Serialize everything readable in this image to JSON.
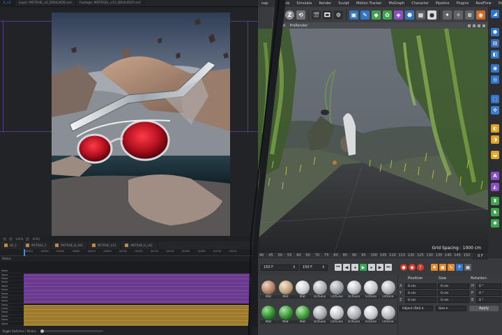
{
  "left_app": {
    "tabs": [
      {
        "label": "E_v2",
        "active": true
      },
      {
        "label": "Layer: MSTRHE_v2_DDHLOOD.ext",
        "active": false
      },
      {
        "label": "Footage: MSTRGEL_v12_BDHL0025.ext",
        "active": false
      }
    ],
    "viewer_controls": [
      "100%",
      "ACES"
    ],
    "layer_tabs": [
      "HE_1",
      "MSTRHE_2",
      "MSTRHE_D_001",
      "MSTRHE_V12",
      "MSTRHE_H_v02"
    ],
    "ruler_ticks": [
      "00015",
      "00030",
      "00045",
      "00060",
      "00075",
      "00090",
      "00105",
      "00120",
      "00135",
      "00150",
      "00165",
      "00180",
      "00195",
      "00210"
    ],
    "status_label": "Status",
    "layer_names": [
      "None",
      "None",
      "None",
      "None",
      "None",
      "None",
      "None",
      "None",
      "None",
      "None",
      "Lines",
      "None",
      "None",
      "None",
      "None"
    ],
    "bottom_label": "Toggle Switches / Modes",
    "colors": {
      "track_purple": "#6a3a8f",
      "track_gold": "#9c7a2e",
      "playhead": "#3a8ee6",
      "guides": "#6a3f9a"
    }
  },
  "right_app": {
    "menu": [
      "nap",
      "Animate",
      "Simulate",
      "Render",
      "Sculpt",
      "Motion Tracker",
      "MoGraph",
      "Character",
      "Pipeline",
      "Plugins",
      "RealFlow",
      "Octa"
    ],
    "panel_menu": [
      "Panel",
      "ProRender"
    ],
    "grid_spacing": "Grid Spacing : 1000 cm",
    "timeline_ticks": [
      "40",
      "45",
      "50",
      "55",
      "60",
      "65",
      "70",
      "75",
      "80",
      "85",
      "90",
      "95",
      "100",
      "105",
      "110",
      "115",
      "120",
      "125",
      "130",
      "135",
      "140",
      "145",
      "150"
    ],
    "current_frame": "0 F",
    "transport": {
      "start_field": "150 F",
      "end_field": "150 F"
    },
    "materials": [
      "Mat",
      "Mat",
      "Mat",
      "OctGlos",
      "OctGlos",
      "OctGlos",
      "Octane",
      "Octane",
      "Mat",
      "Mat",
      "Mat",
      "OctGlos",
      "OctGlos",
      "OctGlos",
      "Octane",
      "Octane"
    ],
    "coords": {
      "headers": {
        "position": "Position",
        "size": "Size",
        "rotation": "Rotation"
      },
      "rows": [
        {
          "axis": "X",
          "position": "0 cm",
          "size": "0 cm",
          "rot_axis": "H",
          "rotation": "0 °"
        },
        {
          "axis": "Y",
          "position": "0 cm",
          "size": "0 cm",
          "rot_axis": "P",
          "rotation": "0 °"
        },
        {
          "axis": "Z",
          "position": "0 cm",
          "size": "0 cm",
          "rot_axis": "B",
          "rotation": "0 °"
        }
      ],
      "object_select": "Object (Rel)",
      "size_select": "Size",
      "apply_label": "Apply"
    }
  }
}
